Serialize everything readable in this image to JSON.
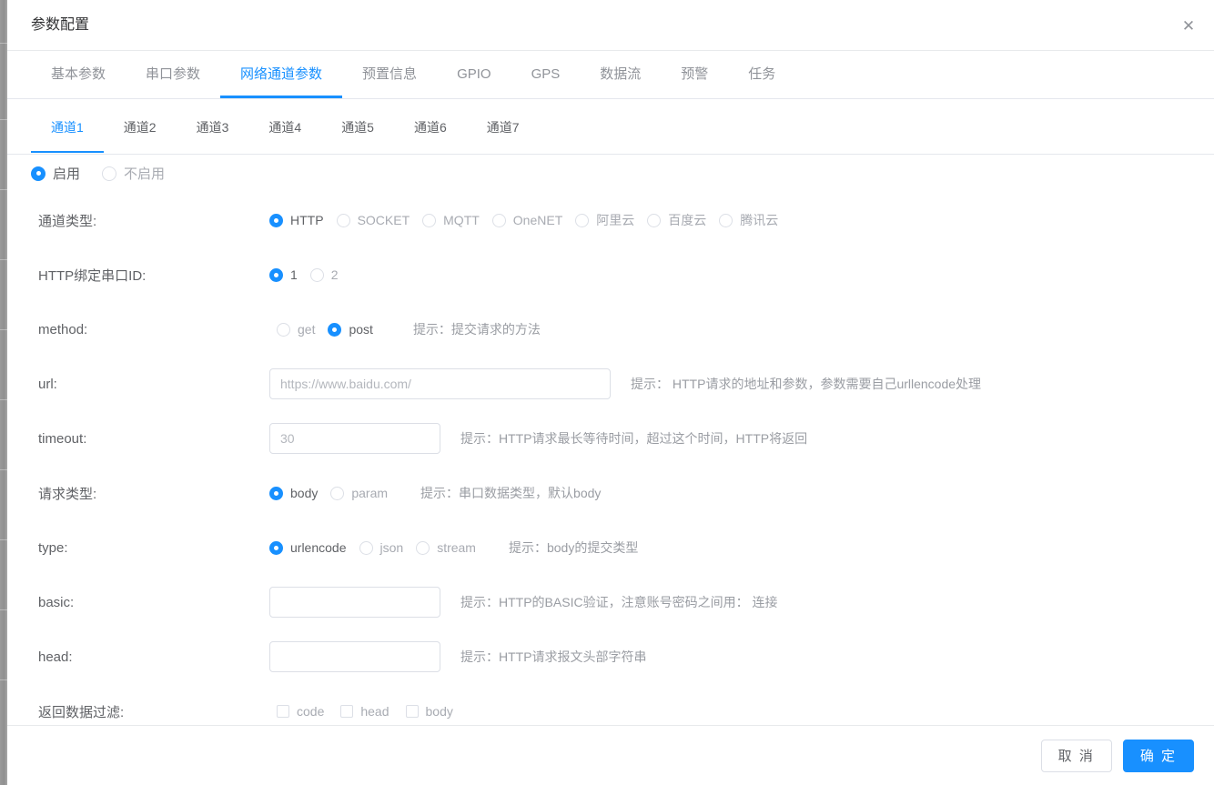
{
  "colors": {
    "accent": "#1890ff",
    "label_text": "#606266",
    "hint_text": "#9a9da3",
    "border": "#dcdfe6",
    "backdrop": "#8a8a8a"
  },
  "dialog": {
    "title": "参数配置",
    "close_icon": "close-icon",
    "close_glyph": "✕"
  },
  "main_tabs": {
    "active_index": 2,
    "items": [
      {
        "label": "基本参数"
      },
      {
        "label": "串口参数"
      },
      {
        "label": "网络通道参数"
      },
      {
        "label": "预置信息"
      },
      {
        "label": "GPIO"
      },
      {
        "label": "GPS"
      },
      {
        "label": "数据流"
      },
      {
        "label": "预警"
      },
      {
        "label": "任务"
      }
    ]
  },
  "sub_tabs": {
    "active_index": 0,
    "items": [
      {
        "label": "通道1"
      },
      {
        "label": "通道2"
      },
      {
        "label": "通道3"
      },
      {
        "label": "通道4"
      },
      {
        "label": "通道5"
      },
      {
        "label": "通道6"
      },
      {
        "label": "通道7"
      }
    ]
  },
  "enable": {
    "options": [
      {
        "label": "启用",
        "checked": true
      },
      {
        "label": "不启用",
        "checked": false
      }
    ]
  },
  "form": {
    "channel_type": {
      "label": "通道类型:",
      "selected": "HTTP",
      "options": [
        {
          "label": "HTTP",
          "checked": true
        },
        {
          "label": "SOCKET",
          "checked": false
        },
        {
          "label": "MQTT",
          "checked": false
        },
        {
          "label": "OneNET",
          "checked": false
        },
        {
          "label": "阿里云",
          "checked": false
        },
        {
          "label": "百度云",
          "checked": false
        },
        {
          "label": "腾讯云",
          "checked": false
        }
      ]
    },
    "bind_serial_id": {
      "label": "HTTP绑定串口ID:",
      "selected": "1",
      "options": [
        {
          "label": "1",
          "checked": true
        },
        {
          "label": "2",
          "checked": false
        }
      ]
    },
    "method": {
      "label": "method:",
      "selected": "post",
      "options": [
        {
          "label": "get",
          "checked": false
        },
        {
          "label": "post",
          "checked": true
        }
      ],
      "hint": "提示：提交请求的方法"
    },
    "url": {
      "label": "url:",
      "value": "",
      "placeholder": "https://www.baidu.com/",
      "hint": "提示：  HTTP请求的地址和参数，参数需要自己urllencode处理"
    },
    "timeout": {
      "label": "timeout:",
      "value": "",
      "placeholder": "30",
      "hint": "提示：HTTP请求最长等待时间，超过这个时间，HTTP将返回"
    },
    "request_type": {
      "label": "请求类型:",
      "selected": "body",
      "options": [
        {
          "label": "body",
          "checked": true
        },
        {
          "label": "param",
          "checked": false
        }
      ],
      "hint": "提示：串口数据类型，默认body"
    },
    "type": {
      "label": "type:",
      "selected": "urlencode",
      "options": [
        {
          "label": "urlencode",
          "checked": true
        },
        {
          "label": "json",
          "checked": false
        },
        {
          "label": "stream",
          "checked": false
        }
      ],
      "hint": "提示：body的提交类型"
    },
    "basic": {
      "label": "basic:",
      "value": "",
      "placeholder": "",
      "hint": "提示：HTTP的BASIC验证，注意账号密码之间用： 连接"
    },
    "head": {
      "label": "head:",
      "value": "",
      "placeholder": "",
      "hint": "提示：HTTP请求报文头部字符串"
    },
    "return_filter": {
      "label": "返回数据过滤:",
      "options": [
        {
          "label": "code",
          "checked": false
        },
        {
          "label": "head",
          "checked": false
        },
        {
          "label": "body",
          "checked": false
        }
      ]
    }
  },
  "footer": {
    "cancel_label": "取 消",
    "confirm_label": "确 定"
  }
}
